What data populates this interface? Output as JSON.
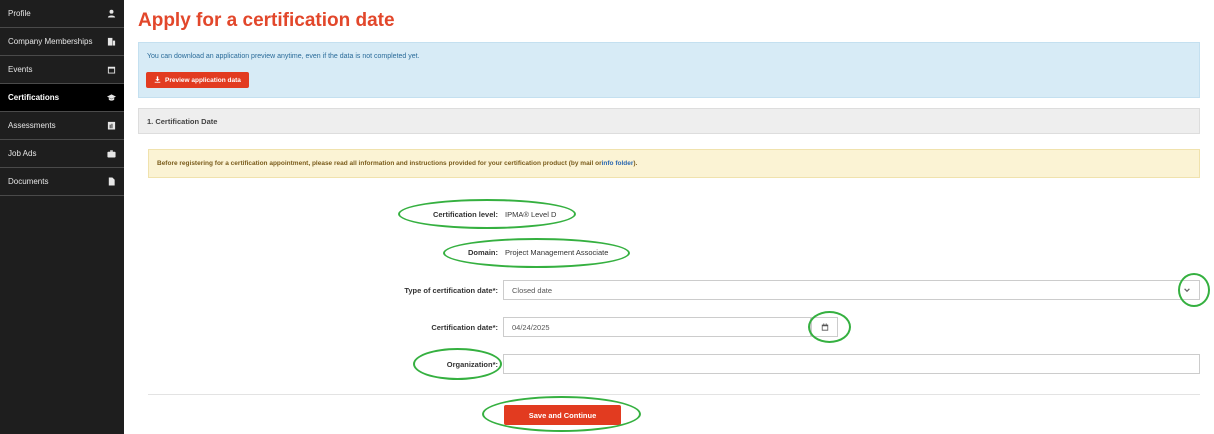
{
  "sidebar": {
    "items": [
      {
        "label": "Profile",
        "icon": "user-icon",
        "active": false
      },
      {
        "label": "Company Memberships",
        "icon": "building-icon",
        "active": false
      },
      {
        "label": "Events",
        "icon": "calendar-icon",
        "active": false
      },
      {
        "label": "Certifications",
        "icon": "graduation-cap-icon",
        "active": true
      },
      {
        "label": "Assessments",
        "icon": "chart-icon",
        "active": false
      },
      {
        "label": "Job Ads",
        "icon": "briefcase-icon",
        "active": false
      },
      {
        "label": "Documents",
        "icon": "file-icon",
        "active": false
      }
    ]
  },
  "main": {
    "title": "Apply for a certification date",
    "info": {
      "text": "You can download an application preview anytime, even if the data is not completed yet.",
      "preview_button": "Preview application data"
    },
    "section_title": "1. Certification Date",
    "warning": {
      "text_before": "Before registering for a certification appointment, please read all information and instructions provided for your certification product (by mail or ",
      "link": "info folder",
      "text_after": ")."
    },
    "form": {
      "certification_level_label": "Certification level:",
      "certification_level_value": "IPMA® Level D",
      "domain_label": "Domain:",
      "domain_value": "Project Management Associate",
      "type_label": "Type of certification date*:",
      "type_value": "Closed date",
      "date_label": "Certification date*:",
      "date_value": "04/24/2025",
      "organization_label": "Organization*:",
      "organization_value": ""
    },
    "save_button": "Save and Continue"
  },
  "colors": {
    "accent": "#e23b20",
    "title": "#e2472b",
    "sidebar_bg": "#1e1e1e",
    "annotation": "#35b040"
  }
}
